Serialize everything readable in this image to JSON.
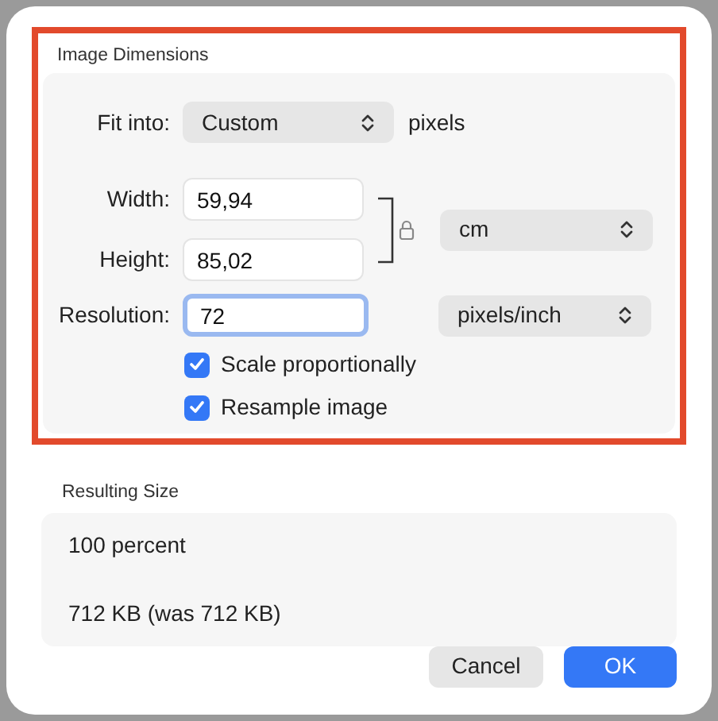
{
  "image_dimensions": {
    "title": "Image Dimensions",
    "highlighted": true,
    "fit_into": {
      "label": "Fit into:",
      "value": "Custom",
      "unit": "pixels"
    },
    "width": {
      "label": "Width:",
      "value": "59,94"
    },
    "height": {
      "label": "Height:",
      "value": "85,02"
    },
    "locked": true,
    "size_unit": "cm",
    "resolution": {
      "label": "Resolution:",
      "value": "72",
      "focused": true
    },
    "resolution_unit": "pixels/inch",
    "options": [
      {
        "label": "Scale proportionally",
        "checked": true
      },
      {
        "label": "Resample image",
        "checked": true
      }
    ]
  },
  "resulting_size": {
    "title": "Resulting Size",
    "percent": "100 percent",
    "size": "712 KB (was 712 KB)"
  },
  "buttons": [
    {
      "label": "Cancel",
      "kind": "secondary"
    },
    {
      "label": "OK",
      "kind": "primary"
    }
  ]
}
